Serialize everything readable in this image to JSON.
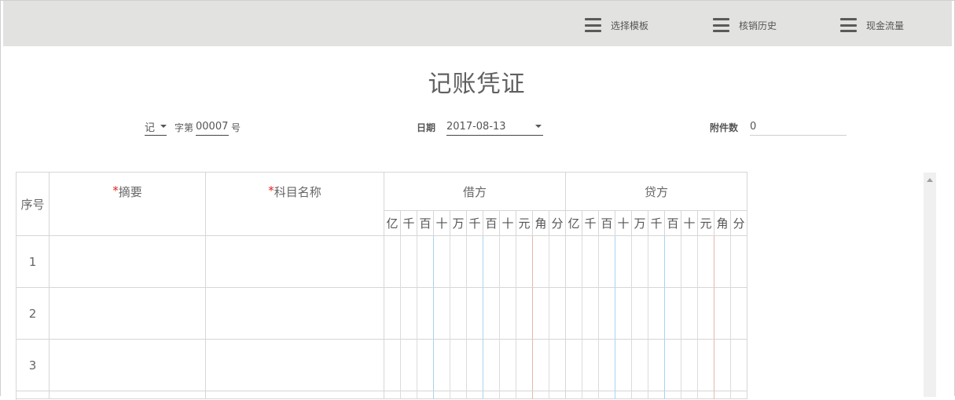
{
  "toolbar": {
    "items": [
      {
        "label": "选择模板",
        "icon": "menu-icon"
      },
      {
        "label": "核销历史",
        "icon": "menu-icon"
      },
      {
        "label": "现金流量",
        "icon": "menu-icon"
      }
    ]
  },
  "voucher": {
    "title": "记账凭证",
    "word": "记",
    "word_suffix_pre": "字第",
    "number": "00007",
    "number_suffix": "号",
    "date_label": "日期",
    "date": "2017-08-13",
    "attachments_label": "附件数",
    "attachments": "0"
  },
  "table": {
    "col_seq": "序号",
    "col_summary_mark": "*",
    "col_summary": "摘要",
    "col_subject_mark": "*",
    "col_subject": "科目名称",
    "col_debit": "借方",
    "col_credit": "贷方",
    "digits": [
      "亿",
      "千",
      "百",
      "十",
      "万",
      "千",
      "百",
      "十",
      "元",
      "角",
      "分"
    ],
    "rows": [
      {
        "seq": "1"
      },
      {
        "seq": "2"
      },
      {
        "seq": "3"
      }
    ]
  },
  "colors": {
    "toolbar_bg": "#e2e2e0",
    "required_mark": "#e02020",
    "digit_separator_blue": "#a8d4ef",
    "digit_separator_red": "#e6b8a8"
  }
}
